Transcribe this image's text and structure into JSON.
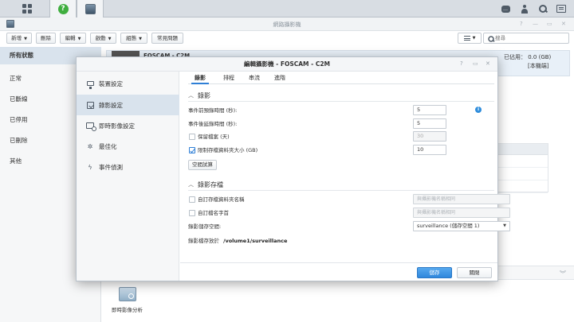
{
  "app": {
    "title": "網路攝影機",
    "toolbar": {
      "new_label": "新增",
      "delete_label": "刪除",
      "edit_label": "編輯",
      "enable_label": "啟動",
      "group_label": "組態",
      "faq_label": "常見問題",
      "search_placeholder": "搜尋"
    },
    "sidebar": {
      "items": [
        {
          "label": "所有狀態",
          "selected": true
        },
        {
          "label": "正常"
        },
        {
          "label": "已斷線"
        },
        {
          "label": "已停用"
        },
        {
          "label": "已刪除"
        },
        {
          "label": "其他"
        }
      ]
    },
    "camera_card": {
      "name": "FOSCAM - C2M",
      "usage": "已佔用： 0.0 (GB)",
      "location": "[本機端]"
    },
    "bottom_panel": {
      "app_label": "即時影像分析"
    }
  },
  "dialog": {
    "title": "編輯攝影機 - FOSCAM - C2M",
    "sidebar": {
      "items": [
        {
          "label": "裝置設定",
          "icon": "device-settings-icon"
        },
        {
          "label": "錄影設定",
          "icon": "recording-settings-icon",
          "selected": true
        },
        {
          "label": "即時影像設定",
          "icon": "live-view-settings-icon"
        },
        {
          "label": "最佳化",
          "icon": "optimization-icon"
        },
        {
          "label": "事件偵測",
          "icon": "event-detection-icon"
        }
      ]
    },
    "tabs": [
      {
        "label": "錄影",
        "active": true
      },
      {
        "label": "排程"
      },
      {
        "label": "串流"
      },
      {
        "label": "進階"
      }
    ],
    "recording_section": {
      "title": "錄影",
      "pre_event_label": "事件前預錄時間 (秒):",
      "pre_event_value": "5",
      "post_event_label": "事件後延錄時間 (秒):",
      "post_event_value": "5",
      "keep_files_label": "保留檔案 (天)",
      "keep_files_value": "30",
      "keep_files_checked": false,
      "limit_size_label": "限制存檔資料夾大小 (GB)",
      "limit_size_value": "10",
      "limit_size_checked": true,
      "estimate_button": "空間試算"
    },
    "archive_section": {
      "title": "錄影存檔",
      "custom_folder_label": "自訂存檔資料夾名稱",
      "custom_folder_placeholder": "與攝影機名稱相同",
      "custom_prefix_label": "自訂檔名字首",
      "custom_prefix_placeholder": "與攝影機名稱相同",
      "storage_label": "錄影儲存空間:",
      "storage_value": "surveillance (儲存空間 1)",
      "path_label": "錄影檔存放於",
      "path_value": "/volume1/surveillance"
    },
    "footer": {
      "save_label": "儲存",
      "close_label": "關閉"
    }
  },
  "colors": {
    "accent": "#2f87dc",
    "selection": "#d9e3ed",
    "help_green": "#3fae3f"
  }
}
